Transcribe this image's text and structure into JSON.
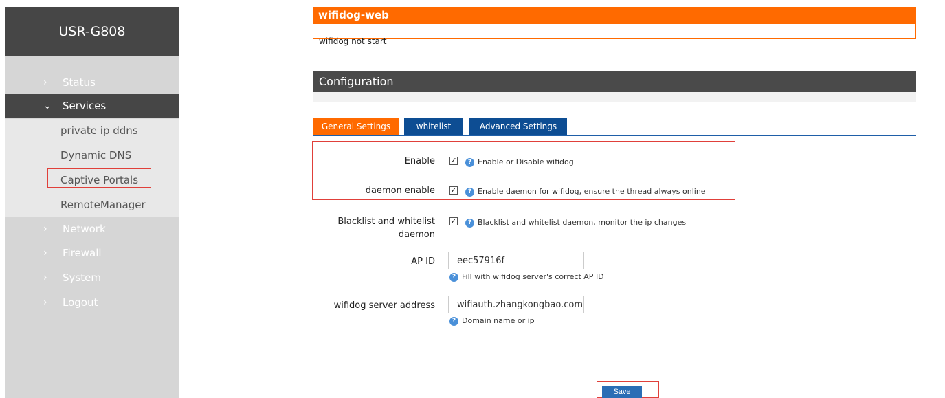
{
  "sidebar": {
    "brand": "USR-G808",
    "items": [
      {
        "label": "Status",
        "chevron": "›"
      },
      {
        "label": "Services",
        "chevron": "⌄"
      },
      {
        "label": "Network",
        "chevron": "›"
      },
      {
        "label": "Firewall",
        "chevron": "›"
      },
      {
        "label": "System",
        "chevron": "›"
      },
      {
        "label": "Logout",
        "chevron": "›"
      }
    ],
    "sub_items": [
      "private ip ddns",
      "Dynamic DNS",
      "Captive Portals",
      "RemoteManager"
    ]
  },
  "status_panel": {
    "title": "wifidog-web",
    "message": "wifidog not start"
  },
  "config": {
    "title": "Configuration",
    "tabs": [
      "General Settings",
      "whitelist",
      "Advanced Settings"
    ]
  },
  "form": {
    "enable": {
      "label": "Enable",
      "checked": true,
      "help": "Enable or Disable wifidog"
    },
    "daemon": {
      "label": "daemon enable",
      "checked": true,
      "help": "Enable daemon for wifidog, ensure the thread always online"
    },
    "blacklist": {
      "label_line1": "Blacklist and whitelist",
      "label_line2": "daemon",
      "checked": true,
      "help": "Blacklist and whitelist daemon, monitor the ip changes"
    },
    "ap_id": {
      "label": "AP ID",
      "value": "eec57916f",
      "help": "Fill with wifidog server's correct AP ID"
    },
    "server": {
      "label": "wifidog server address",
      "value": "wifiauth.zhangkongbao.com",
      "help": "Domain name or ip"
    }
  },
  "actions": {
    "save_label": "Save"
  },
  "colors": {
    "accent": "#ff6a00",
    "tab_blue": "#0d4d93",
    "highlight": "#e0403a"
  }
}
